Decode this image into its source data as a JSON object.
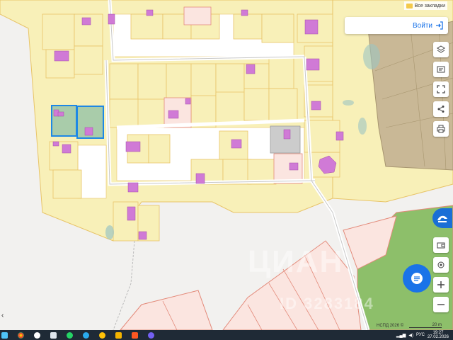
{
  "bookmarks": {
    "label": "Все закладки"
  },
  "header": {
    "login_label": "Войти"
  },
  "map": {
    "watermark_brand": "ЦИАН",
    "watermark_id": "ID 3283184",
    "attribution": "НСПД 2026 ©",
    "scale_label": "20 m"
  },
  "tools": [
    "layers-icon",
    "map-type-icon",
    "select-area-icon",
    "share-icon",
    "print-icon"
  ],
  "right_controls": [
    "cian-logo-icon",
    "wallet-icon",
    "location-icon",
    "zoom-in-icon",
    "zoom-out-icon"
  ],
  "taskbar": {
    "apps": [
      "windows-start-icon",
      "chrome-icon",
      "yandex-icon",
      "file-explorer-icon",
      "whatsapp-icon",
      "telegram-icon",
      "weather-icon",
      "file-manager-icon",
      "gallery-icon",
      "viber-icon"
    ],
    "language": "РУС",
    "time": "19:27",
    "date": "27.02.2026"
  },
  "colors": {
    "parcel_fill": "#f8f0b8",
    "parcel_stroke": "#e8c468",
    "building": "#d07ad6",
    "selected": "#1e88e5",
    "accent": "#1a73e8",
    "green_area": "#8dbf6a",
    "brown_area": "#c9b896"
  }
}
